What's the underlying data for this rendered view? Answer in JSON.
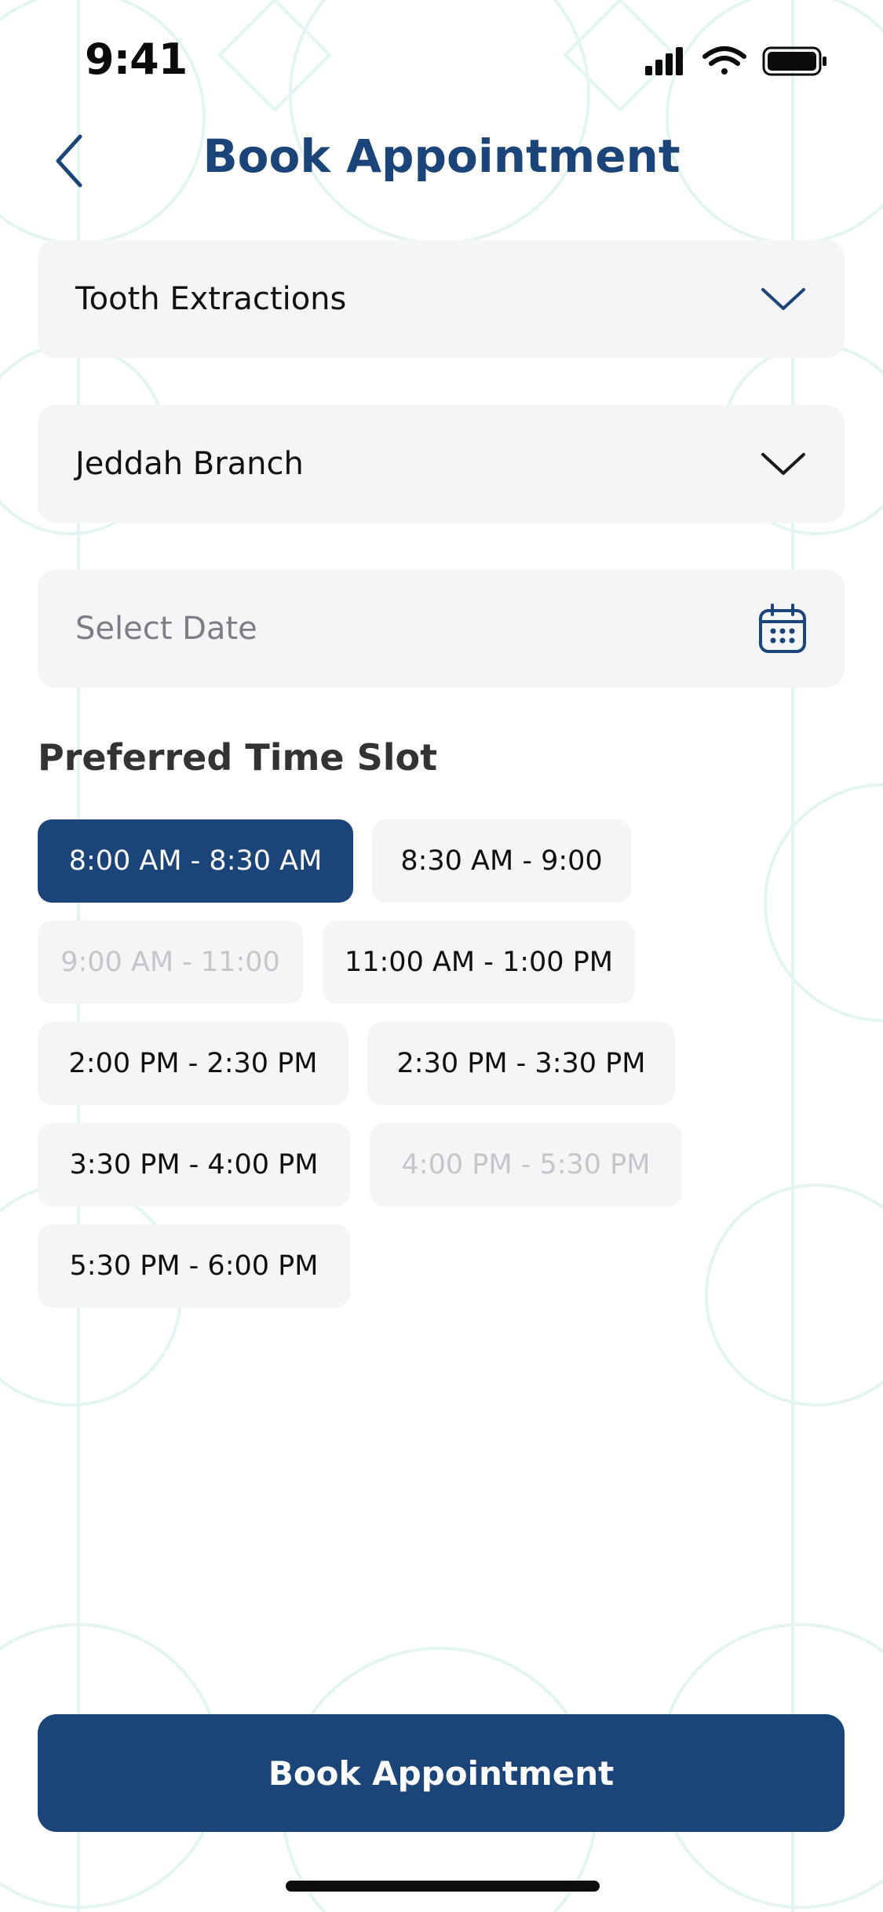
{
  "status_bar": {
    "time": "9:41",
    "icons": [
      "signal-icon",
      "wifi-icon",
      "battery-icon"
    ]
  },
  "header": {
    "title": "Book Appointment",
    "back_icon": "chevron-left-icon"
  },
  "form": {
    "service": {
      "value": "Tooth Extractions",
      "icon": "chevron-down-icon"
    },
    "branch": {
      "value": "Jeddah Branch",
      "icon": "chevron-down-icon"
    },
    "date": {
      "placeholder": "Select Date",
      "icon": "calendar-icon"
    }
  },
  "time_slots": {
    "title": "Preferred Time Slot",
    "slots": [
      {
        "label": "8:00 AM - 8:30 AM",
        "state": "selected"
      },
      {
        "label": "8:30 AM - 9:00",
        "state": "available"
      },
      {
        "label": "9:00 AM - 11:00",
        "state": "disabled"
      },
      {
        "label": "11:00 AM - 1:00 PM",
        "state": "available"
      },
      {
        "label": "2:00 PM - 2:30 PM",
        "state": "available"
      },
      {
        "label": "2:30 PM - 3:30 PM",
        "state": "available"
      },
      {
        "label": "3:30 PM - 4:00 PM",
        "state": "available"
      },
      {
        "label": "4:00 PM - 5:30 PM",
        "state": "disabled"
      },
      {
        "label": "5:30 PM - 6:00 PM",
        "state": "available"
      }
    ]
  },
  "footer": {
    "book_label": "Book Appointment"
  },
  "colors": {
    "primary": "#1b4478",
    "field_bg": "#f4f5f7",
    "pattern": "#dff3f1",
    "disabled_text": "#c4c6cb"
  }
}
